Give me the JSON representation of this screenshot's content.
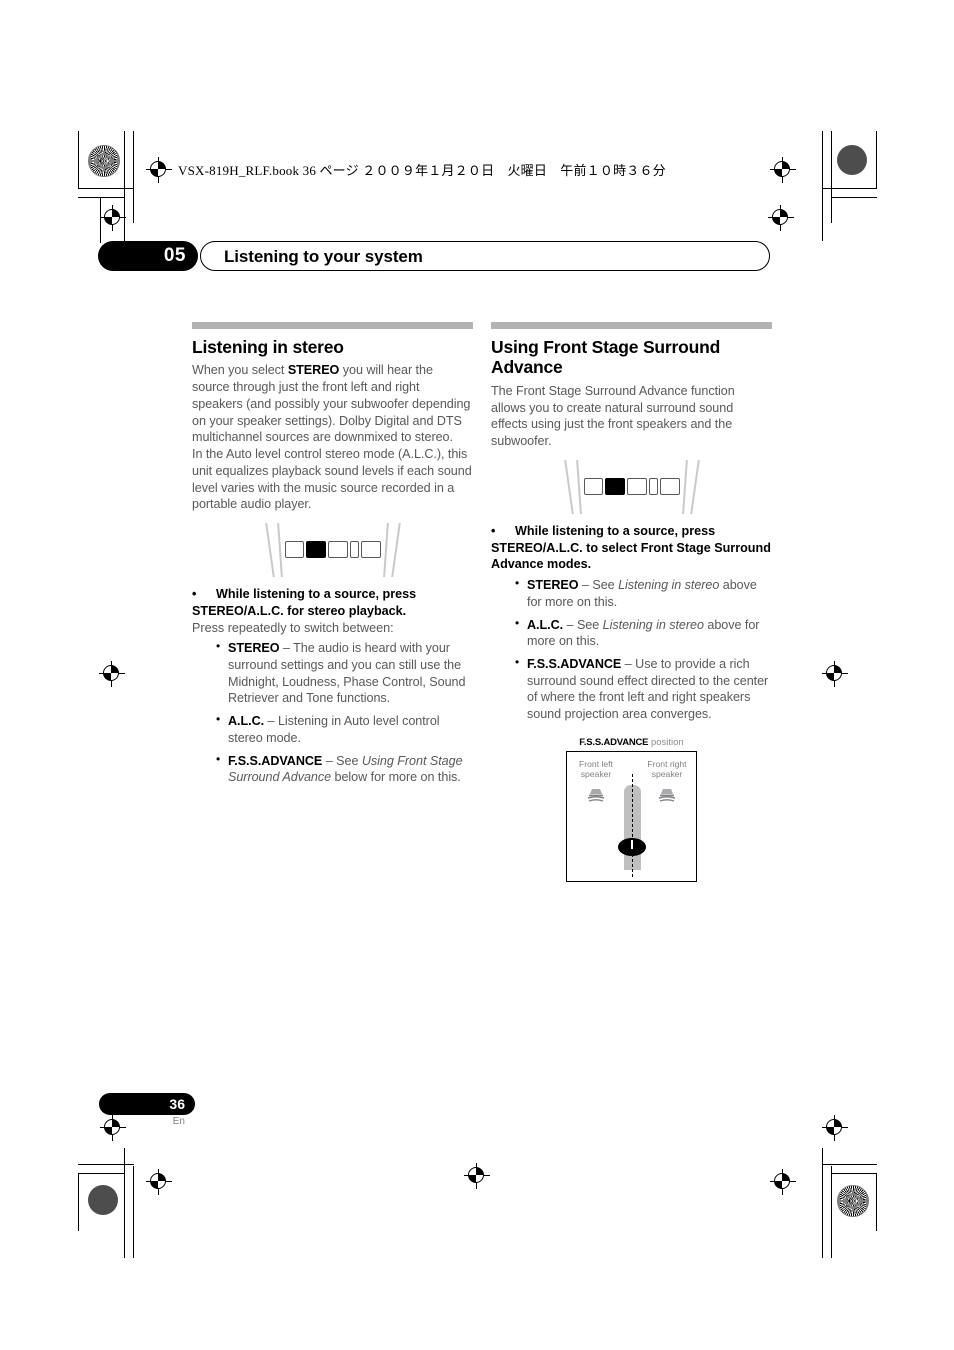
{
  "print_header": {
    "text": "VSX-819H_RLF.book   36 ページ   ２００９年１月２０日　火曜日　午前１０時３６分"
  },
  "chapter": {
    "number": "05",
    "title": "Listening to your system"
  },
  "left_column": {
    "heading": "Listening in stereo",
    "intro_1_a": "When you select ",
    "intro_1_b": "STEREO",
    "intro_1_c": " you will hear the source through just the front left and right speakers (and possibly your subwoofer depending on your speaker settings). Dolby Digital and DTS multichannel sources are downmixed to stereo.",
    "intro_2": "In the Auto level control stereo mode (A.L.C.), this unit equalizes playback sound levels if each sound level varies with the music source recorded in a portable audio player.",
    "instruction": "While listening to a source, press STEREO/A.L.C. for stereo playback.",
    "instruction_note": "Press repeatedly to switch between:",
    "bullets": [
      {
        "term": "STEREO",
        "dash": " – ",
        "text": "The audio is heard with your surround settings and you can still use the Midnight, Loudness, Phase Control, Sound Retriever and Tone functions."
      },
      {
        "term": "A.L.C.",
        "dash": " – ",
        "text": "Listening in Auto level control stereo mode."
      },
      {
        "term": "F.S.S.ADVANCE",
        "dash": " – ",
        "text_a": "See ",
        "text_italic": "Using Front Stage Surround Advance",
        "text_b": " below for more on this."
      }
    ]
  },
  "right_column": {
    "heading": "Using Front Stage Surround Advance",
    "intro": "The Front Stage Surround Advance function allows you to create natural surround sound effects using just the front speakers and the subwoofer.",
    "instruction": "While listening to a source, press STEREO/A.L.C. to select Front Stage Surround Advance modes.",
    "bullets": [
      {
        "term": "STEREO",
        "dash": " – ",
        "text_a": "See ",
        "text_italic": "Listening in stereo",
        "text_b": " above for more on this."
      },
      {
        "term": "A.L.C.",
        "dash": " – ",
        "text_a": "See ",
        "text_italic": "Listening in stereo",
        "text_b": " above for more on this."
      },
      {
        "term": "F.S.S.ADVANCE",
        "dash": " – ",
        "text_a": "Use to provide a rich surround sound effect directed to the center of where the front left and right speakers sound projection area converges.",
        "text_italic": "",
        "text_b": ""
      }
    ],
    "diagram": {
      "caption_bold": "F.S.S.ADVANCE",
      "caption_rest": " position",
      "label_left": "Front left speaker",
      "label_right": "Front right speaker"
    }
  },
  "footer": {
    "page_number": "36",
    "language": "En"
  },
  "colors": {
    "body_text": "#58595b",
    "heading": "#000000",
    "rule": "#b3b3b3",
    "diagram_bar": "#bfbfbf",
    "label_gray": "#808285"
  }
}
